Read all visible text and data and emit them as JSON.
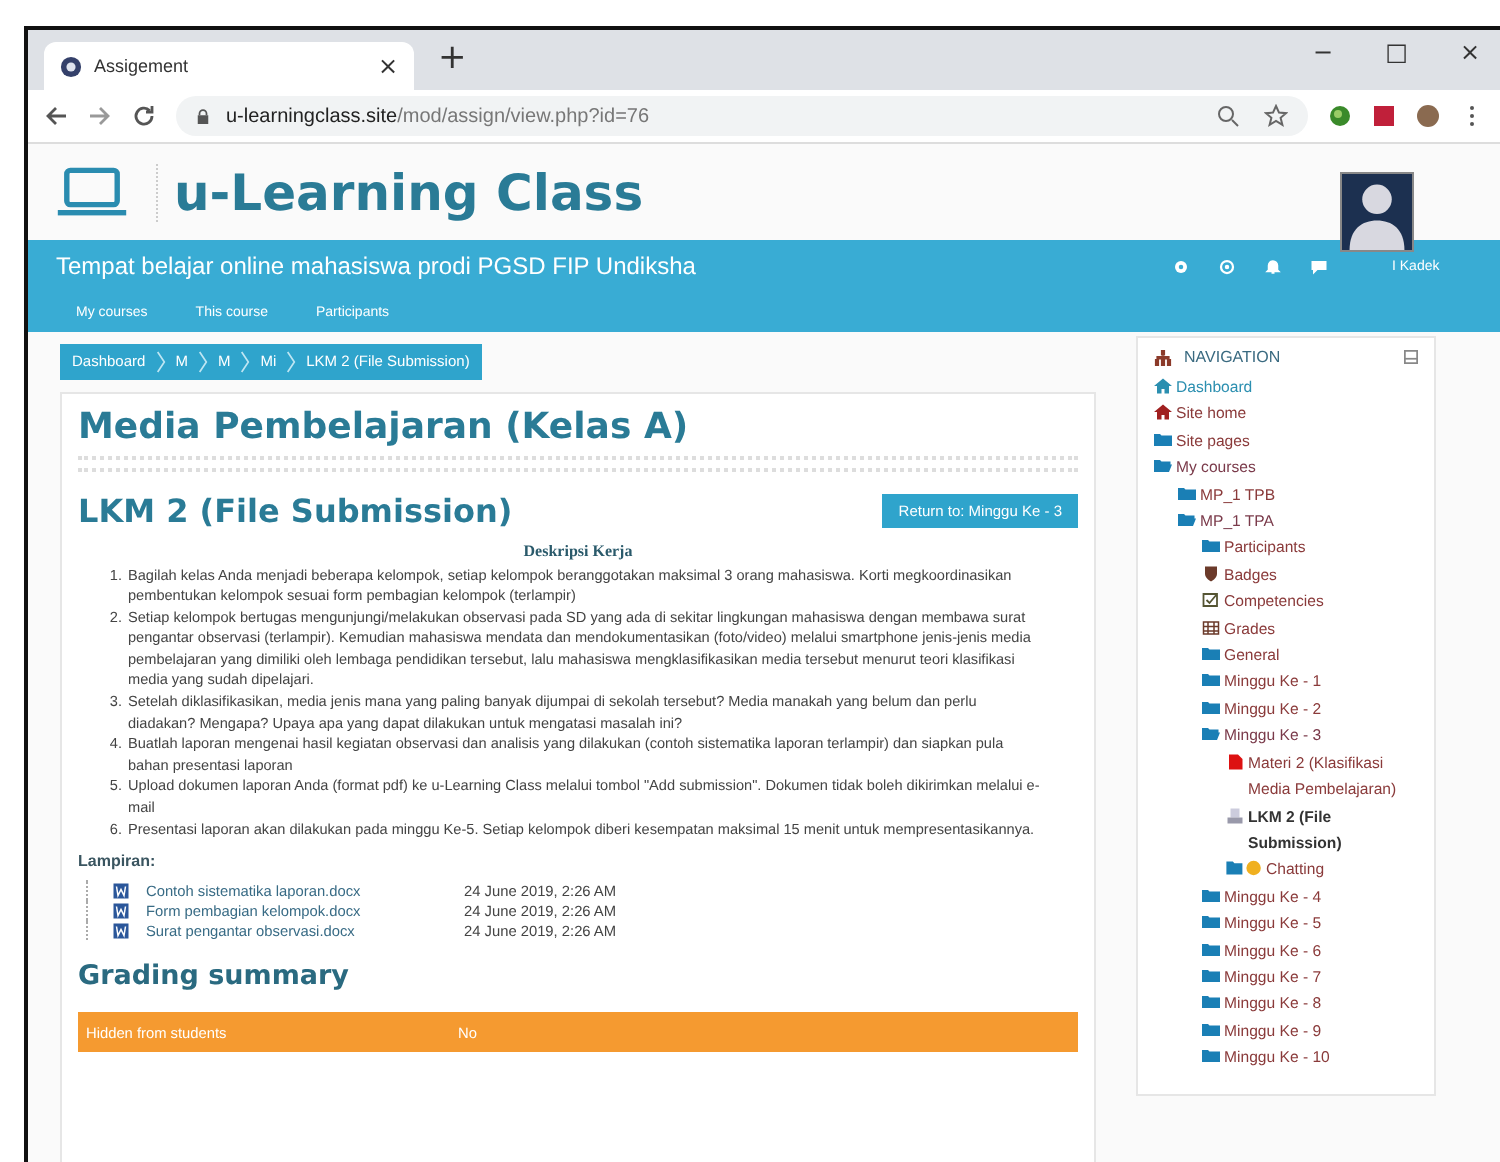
{
  "browser": {
    "tab": {
      "title": "Assigement",
      "close": "×"
    },
    "new_tab": "+",
    "window_controls": [
      "−",
      "□",
      "×"
    ],
    "url": {
      "host": "u-learningclass.site",
      "path": "/mod/assign/view.php?id=76"
    }
  },
  "site": {
    "name": "u-Learning Class",
    "tagline": "Tempat belajar online mahasiswa prodi PGSD FIP Undiksha",
    "user": "I Kadek",
    "menu": [
      "My courses",
      "This course",
      "Participants"
    ]
  },
  "breadcrumb": [
    "Dashboard",
    "M",
    "M",
    "Mi",
    "LKM 2 (File Submission)"
  ],
  "course_title": "Media Pembelajaran (Kelas A)",
  "page_title": "LKM 2 (File Submission)",
  "return_button": "Return to: Minggu Ke - 3",
  "description": {
    "heading": "Deskripsi Kerja",
    "steps": [
      {
        "number": "1.",
        "text": "Bagilah kelas Anda menjadi beberapa kelompok, setiap kelompok beranggotakan maksimal 3 orang mahasiswa. Korti megkoordinasikan pembentukan kelompok sesuai form pembagian kelompok (terlampir)"
      },
      {
        "number": "2.",
        "text": "Setiap kelompok bertugas mengunjungi/melakukan observasi pada SD yang ada di sekitar lingkungan mahasiswa dengan membawa surat pengantar observasi (terlampir). Kemudian mahasiswa mendata dan mendokumentasikan (foto/video) melalui smartphone jenis-jenis media pembelajaran yang dimiliki oleh lembaga pendidikan tersebut, lalu mahasiswa mengklasifikasikan media tersebut menurut teori klasifikasi media yang sudah dipelajari."
      },
      {
        "number": "3.",
        "text": "Setelah diklasifikasikan, media jenis mana yang paling banyak dijumpai di sekolah tersebut? Media manakah yang belum dan perlu diadakan? Mengapa? Upaya apa yang dapat dilakukan untuk mengatasi masalah ini?"
      },
      {
        "number": "4.",
        "text": "Buatlah laporan mengenai hasil kegiatan observasi dan analisis yang dilakukan (contoh sistematika laporan terlampir) dan siapkan pula bahan presentasi laporan"
      },
      {
        "number": "5.",
        "text": "Upload dokumen laporan Anda (format pdf) ke u-Learning Class melalui tombol \"Add submission\". Dokumen tidak boleh dikirimkan melalui e-mail"
      },
      {
        "number": "6.",
        "text": "Presentasi laporan akan dilakukan pada minggu Ke-5. Setiap kelompok diberi kesempatan maksimal 15 menit untuk mempresentasikannya."
      }
    ]
  },
  "attachments": {
    "label": "Lampiran:",
    "files": [
      {
        "name": "Contoh sistematika laporan.docx",
        "date": "24 June 2019, 2:26 AM"
      },
      {
        "name": "Form pembagian kelompok.docx",
        "date": "24 June 2019, 2:26 AM"
      },
      {
        "name": "Surat pengantar observasi.docx",
        "date": "24 June 2019, 2:26 AM"
      }
    ]
  },
  "grading": {
    "heading": "Grading summary",
    "rows": [
      {
        "label": "Hidden from students",
        "value": "No"
      }
    ]
  },
  "navigation": {
    "title": "NAVIGATION",
    "items": [
      {
        "label": "Dashboard",
        "kind": "dashboard"
      },
      {
        "label": "Site home",
        "kind": "home"
      },
      {
        "label": "Site pages",
        "kind": "folder"
      },
      {
        "label": "My courses",
        "kind": "folder",
        "expanded": true,
        "children": [
          {
            "label": "MP_1 TPB",
            "kind": "folder",
            "expanded": false
          },
          {
            "label": "MP_1 TPA",
            "kind": "folder",
            "expanded": true,
            "children": [
              {
                "label": "Participants",
                "kind": "folder"
              },
              {
                "label": "Badges",
                "kind": "badge"
              },
              {
                "label": "Competencies",
                "kind": "check"
              },
              {
                "label": "Grades",
                "kind": "grid"
              },
              {
                "label": "General",
                "kind": "folder",
                "expanded": false
              },
              {
                "label": "Minggu Ke - 1",
                "kind": "folder",
                "expanded": false
              },
              {
                "label": "Minggu Ke - 2",
                "kind": "folder",
                "expanded": false
              },
              {
                "label": "Minggu Ke - 3",
                "kind": "folder",
                "expanded": true,
                "children": [
                  {
                    "label": "Materi 2 (Klasifikasi Media Pembelajaran)",
                    "kind": "pdf",
                    "current": false
                  },
                  {
                    "label": "LKM 2 (File Submission)",
                    "kind": "assign",
                    "current": true
                  },
                  {
                    "label": "Chatting",
                    "kind": "chat",
                    "current": false
                  }
                ]
              },
              {
                "label": "Minggu Ke - 4",
                "kind": "folder",
                "expanded": false
              },
              {
                "label": "Minggu Ke - 5",
                "kind": "folder",
                "expanded": false
              },
              {
                "label": "Minggu Ke - 6",
                "kind": "folder",
                "expanded": false
              },
              {
                "label": "Minggu Ke - 7",
                "kind": "folder",
                "expanded": false
              },
              {
                "label": "Minggu Ke - 8",
                "kind": "folder",
                "expanded": false
              },
              {
                "label": "Minggu Ke - 9",
                "kind": "folder",
                "expanded": false
              },
              {
                "label": "Minggu Ke - 10",
                "kind": "folder",
                "expanded": false
              }
            ]
          }
        ]
      }
    ]
  }
}
